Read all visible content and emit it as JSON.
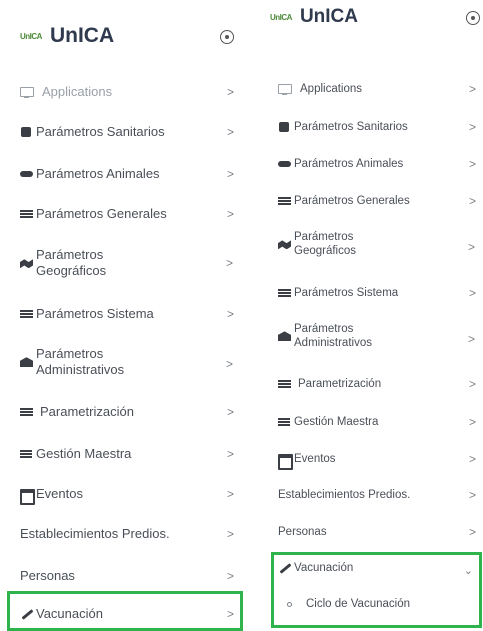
{
  "left": {
    "brand": {
      "logo_text": "UnICA",
      "title": "UnICA"
    },
    "menu": [
      {
        "label": "Applications",
        "icon": "monitor-icon"
      },
      {
        "label": "Parámetros Sanitarios",
        "icon": "square-icon"
      },
      {
        "label": "Parámetros Animales",
        "icon": "car-icon"
      },
      {
        "label": "Parámetros Generales",
        "icon": "sliders-icon"
      },
      {
        "label": "Parámetros Geográficos",
        "icon": "map-icon"
      },
      {
        "label": "Parámetros Sistema",
        "icon": "sliders-icon"
      },
      {
        "label": "Parámetros Administrativos",
        "icon": "bank-icon"
      },
      {
        "label": "Parametrización",
        "icon": "sliders-icon"
      },
      {
        "label": "Gestión Maestra",
        "icon": "list-icon"
      },
      {
        "label": "Eventos",
        "icon": "calendar-icon"
      },
      {
        "label": "Establecimientos Predios.",
        "icon": ""
      },
      {
        "label": "Personas",
        "icon": ""
      },
      {
        "label": "Vacunación",
        "icon": "syringe-icon"
      }
    ],
    "chevron": ">"
  },
  "right": {
    "brand": {
      "logo_text": "UnICA",
      "title": "UnICA"
    },
    "menu": [
      {
        "label": "Applications",
        "icon": "monitor-icon"
      },
      {
        "label": "Parámetros Sanitarios",
        "icon": "square-icon"
      },
      {
        "label": "Parámetros Animales",
        "icon": "car-icon"
      },
      {
        "label": "Parámetros Generales",
        "icon": "sliders-icon"
      },
      {
        "label": "Parámetros Geográficos",
        "icon": "map-icon"
      },
      {
        "label": "Parámetros Sistema",
        "icon": "sliders-icon"
      },
      {
        "label": "Parámetros Administrativos",
        "icon": "bank-icon"
      },
      {
        "label": "Parametrización",
        "icon": "sliders-icon"
      },
      {
        "label": "Gestión Maestra",
        "icon": "list-icon"
      },
      {
        "label": "Eventos",
        "icon": "calendar-icon"
      },
      {
        "label": "Establecimientos Predios.",
        "icon": ""
      },
      {
        "label": "Personas",
        "icon": ""
      },
      {
        "label": "Vacunación",
        "icon": "syringe-icon"
      }
    ],
    "submenu": [
      {
        "label": "Ciclo de Vacunación"
      }
    ],
    "chevron": ">",
    "chevron_open": "⌄"
  },
  "colors": {
    "highlight": "#2fb34d",
    "text": "#4a4f57",
    "faded": "#9aa0a8",
    "brand": "#2f3a4e",
    "logo": "#4f8a3a"
  }
}
